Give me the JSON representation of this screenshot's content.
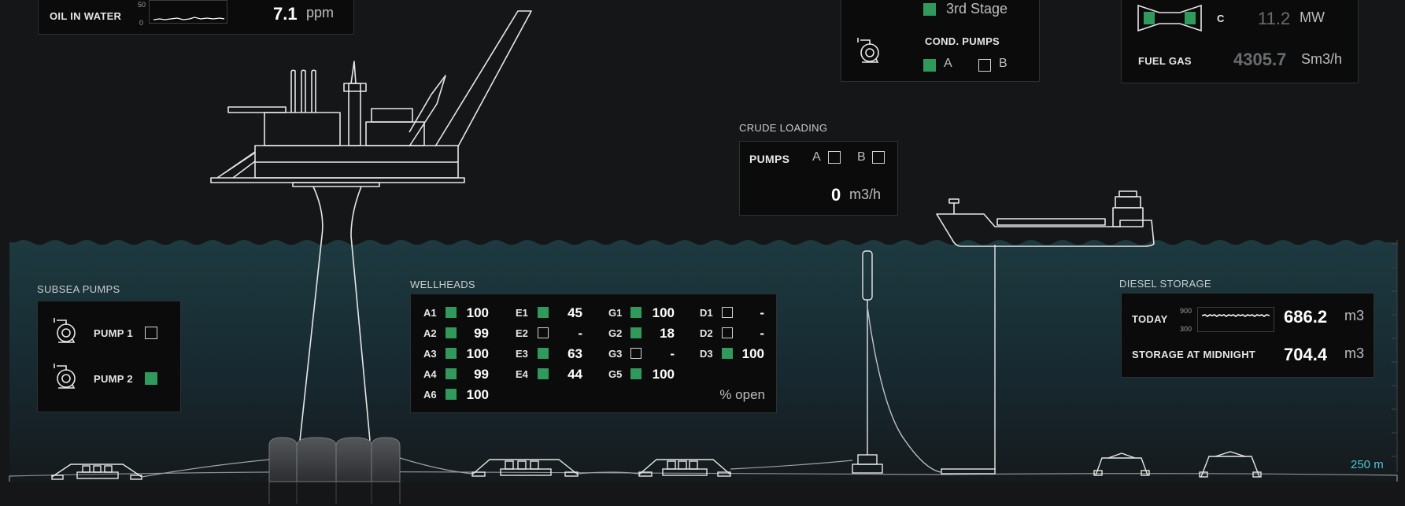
{
  "colors": {
    "background": "#151617",
    "sea_top": "#1d3a40",
    "sea_bottom": "#151a1d",
    "panel_bg": "#0b0b0c",
    "active_green": "#2f9a5c",
    "line_white": "#e6e6e6",
    "depth_label": "#4fc3d4"
  },
  "oil_in_water": {
    "label": "OIL IN WATER",
    "axis_max": "50",
    "axis_min": "0",
    "value": "7.1",
    "unit": "ppm"
  },
  "compression": {
    "stage_label": "3rd Stage",
    "stage_active": true,
    "cond_pumps_label": "COND. PUMPS",
    "pumps": [
      {
        "label": "A",
        "active": true
      },
      {
        "label": "B",
        "active": false
      }
    ]
  },
  "turbine": {
    "unit_label": "C",
    "power_value": "11.2",
    "power_unit": "MW",
    "fuel_gas_label": "FUEL GAS",
    "fuel_gas_value": "4305.7",
    "fuel_gas_unit": "Sm3/h"
  },
  "crude_loading": {
    "title": "CRUDE LOADING",
    "pumps_label": "PUMPS",
    "pumps": [
      {
        "label": "A",
        "active": false
      },
      {
        "label": "B",
        "active": false
      }
    ],
    "flow_value": "0",
    "flow_unit": "m3/h"
  },
  "subsea_pumps": {
    "title": "SUBSEA PUMPS",
    "pumps": [
      {
        "label": "PUMP 1",
        "active": false
      },
      {
        "label": "PUMP 2",
        "active": true
      }
    ]
  },
  "wellheads": {
    "title": "WELLHEADS",
    "unit_label": "% open",
    "columns": [
      [
        {
          "id": "A1",
          "active": true,
          "value": "100"
        },
        {
          "id": "A2",
          "active": true,
          "value": "99"
        },
        {
          "id": "A3",
          "active": true,
          "value": "100"
        },
        {
          "id": "A4",
          "active": true,
          "value": "99"
        },
        {
          "id": "A6",
          "active": true,
          "value": "100"
        }
      ],
      [
        {
          "id": "E1",
          "active": true,
          "value": "45"
        },
        {
          "id": "E2",
          "active": false,
          "value": "-"
        },
        {
          "id": "E3",
          "active": true,
          "value": "63"
        },
        {
          "id": "E4",
          "active": true,
          "value": "44"
        }
      ],
      [
        {
          "id": "G1",
          "active": true,
          "value": "100"
        },
        {
          "id": "G2",
          "active": true,
          "value": "18"
        },
        {
          "id": "G3",
          "active": false,
          "value": "-"
        },
        {
          "id": "G5",
          "active": true,
          "value": "100"
        }
      ],
      [
        {
          "id": "D1",
          "active": false,
          "value": "-"
        },
        {
          "id": "D2",
          "active": false,
          "value": "-"
        },
        {
          "id": "D3",
          "active": true,
          "value": "100"
        }
      ]
    ]
  },
  "diesel_storage": {
    "title": "DIESEL STORAGE",
    "today_label": "TODAY",
    "axis_max": "900",
    "axis_min": "300",
    "today_value": "686.2",
    "today_unit": "m3",
    "midnight_label": "STORAGE AT MIDNIGHT",
    "midnight_value": "704.4",
    "midnight_unit": "m3"
  },
  "depth_label": "250 m"
}
